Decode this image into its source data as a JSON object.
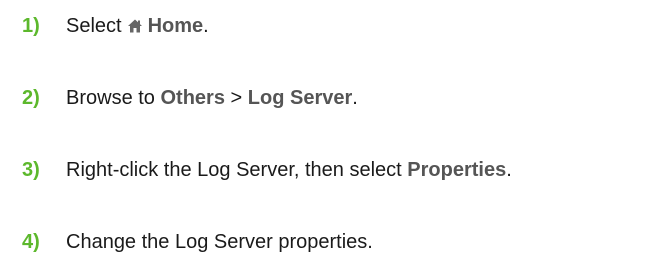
{
  "steps": [
    {
      "number": "1)",
      "prefix": "Select",
      "icon": "home-icon",
      "ui_label": "Home",
      "suffix": "."
    },
    {
      "number": "2)",
      "prefix": "Browse to",
      "ui_label_1": "Others",
      "separator": ">",
      "ui_label_2": "Log Server",
      "suffix": "."
    },
    {
      "number": "3)",
      "prefix": "Right-click the Log Server, then select",
      "ui_label": "Properties",
      "suffix": "."
    },
    {
      "number": "4)",
      "text": "Change the Log Server properties."
    }
  ],
  "colors": {
    "step_number": "#5cb82c",
    "ui_label": "#555555",
    "body_text": "#1a1a1a"
  }
}
